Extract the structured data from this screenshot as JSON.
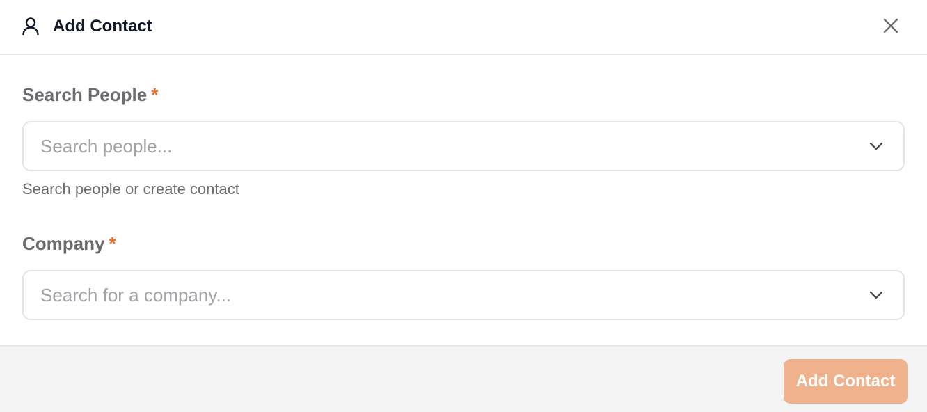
{
  "dialog": {
    "title": "Add Contact",
    "header_icon": "user-icon",
    "close_icon": "close-icon"
  },
  "fields": {
    "people": {
      "label": "Search People",
      "required_mark": "*",
      "value": "",
      "placeholder": "Search people...",
      "help_text": "Search people or create contact",
      "chevron_icon": "chevron-down-icon"
    },
    "company": {
      "label": "Company",
      "required_mark": "*",
      "value": "",
      "placeholder": "Search for a company...",
      "chevron_icon": "chevron-down-icon"
    }
  },
  "footer": {
    "submit_label": "Add Contact"
  },
  "colors": {
    "accent": "#ea6d2a",
    "submit_disabled": "#f0b18d",
    "footer_bg": "#f4f4f5",
    "border": "#e3e4e8"
  }
}
